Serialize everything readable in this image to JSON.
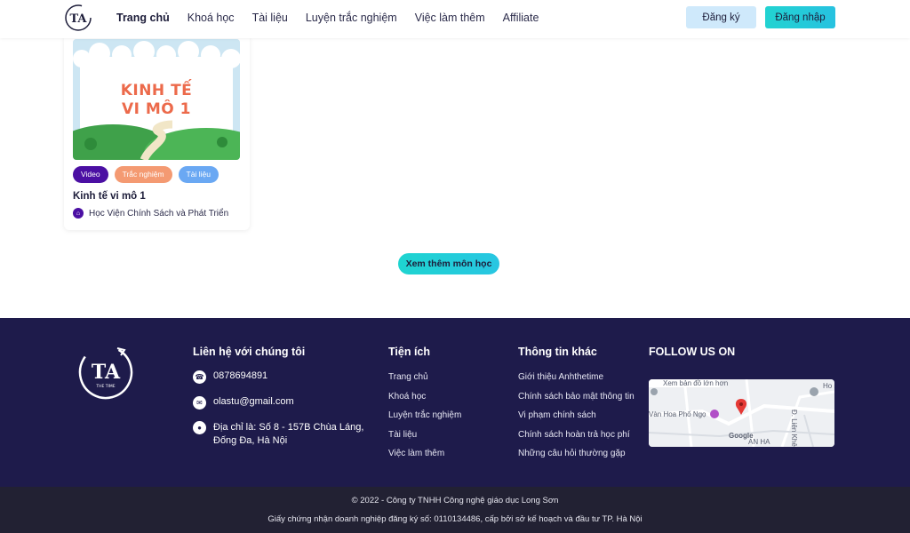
{
  "header": {
    "logo_text": "TA",
    "nav": [
      {
        "label": "Trang chủ",
        "active": true
      },
      {
        "label": "Khoá học",
        "active": false
      },
      {
        "label": "Tài liệu",
        "active": false
      },
      {
        "label": "Luyện trắc nghiệm",
        "active": false
      },
      {
        "label": "Việc làm thêm",
        "active": false
      },
      {
        "label": "Affiliate",
        "active": false
      }
    ],
    "register_label": "Đăng ký",
    "login_label": "Đăng nhập"
  },
  "course": {
    "thumbnail_title_line1": "KINH TẾ",
    "thumbnail_title_line2": "VI MÔ 1",
    "tags": [
      "Video",
      "Trắc nghiệm",
      "Tài liệu"
    ],
    "name": "Kinh tế vi mô 1",
    "school": "Học Viện Chính Sách và Phát Triển"
  },
  "more_button_label": "Xem thêm môn học",
  "footer": {
    "logo_text": "TA",
    "logo_subtext": "THE TIME",
    "contact": {
      "title": "Liên hệ với chúng tôi",
      "phone": "0878694891",
      "email": "olastu@gmail.com",
      "address": "Địa chỉ là: Số 8 - 157B Chùa Láng, Đống Đa, Hà Nội"
    },
    "utilities": {
      "title": "Tiện ích",
      "links": [
        "Trang chủ",
        "Khoá học",
        "Luyện trắc nghiệm",
        "Tài liệu",
        "Việc làm thêm"
      ]
    },
    "info": {
      "title": "Thông tin khác",
      "links": [
        "Giới thiệu Anhthetime",
        "Chính sách bảo mật thông tin",
        "Vi phạm chính sách",
        "Chính sách hoàn trả học phí",
        "Những câu hỏi thường gặp"
      ]
    },
    "follow": {
      "title": "FOLLOW US ON",
      "map_top_text": "Xem bản đồ lớn hơn",
      "map_place": "Vàn Hoa Phố Ngọ",
      "map_brand": "Google",
      "map_area": "AN HA",
      "map_road": "Đ. Liên Khê",
      "map_corner": "Ho sá"
    },
    "copyright": "© 2022 - Công ty TNHH Công nghệ giáo dục Long Sơn",
    "license": "Giấy chứng nhận doanh nghiệp đăng ký số: 0110134486, cấp bởi sở kế hoạch và đầu tư TP. Hà Nội"
  }
}
